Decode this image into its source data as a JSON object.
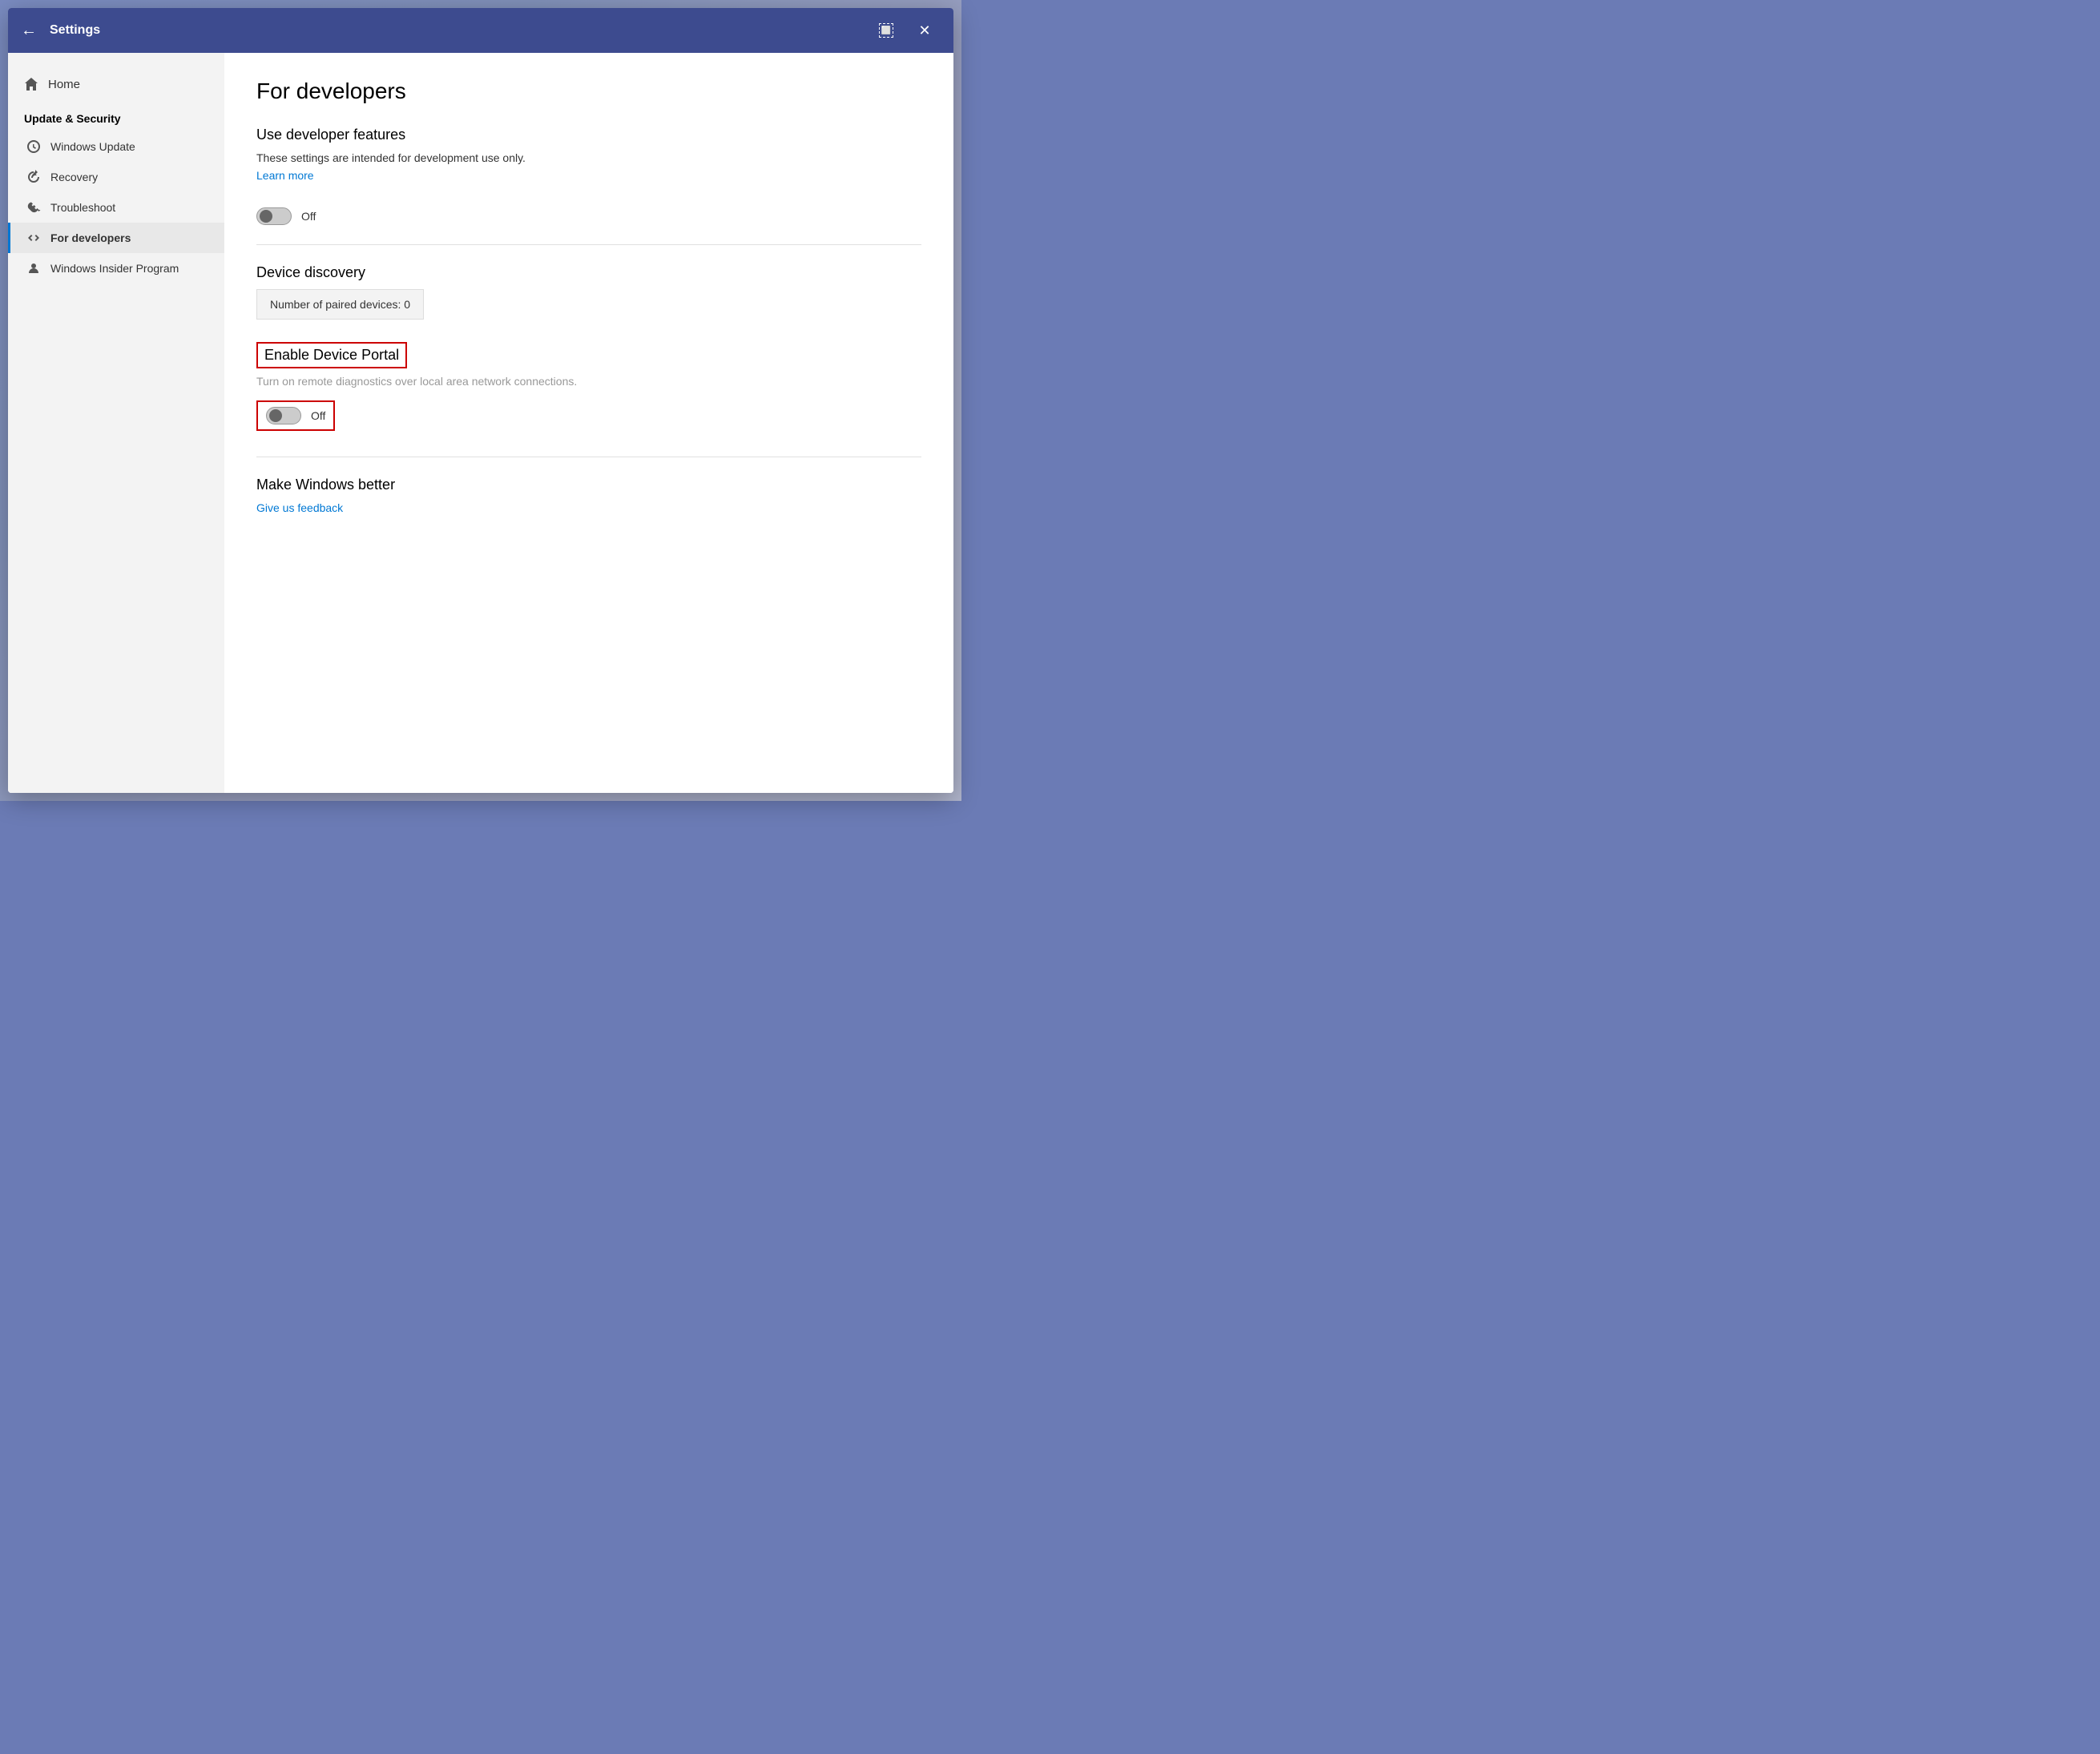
{
  "titleBar": {
    "title": "Settings",
    "backLabel": "←",
    "windowControls": {
      "snap": "⬜",
      "close": "✕"
    }
  },
  "sidebar": {
    "homeLabel": "Home",
    "sectionTitle": "Update & Security",
    "items": [
      {
        "id": "windows-update",
        "label": "Windows Update",
        "icon": "update"
      },
      {
        "id": "recovery",
        "label": "Recovery",
        "icon": "recovery"
      },
      {
        "id": "troubleshoot",
        "label": "Troubleshoot",
        "icon": "troubleshoot"
      },
      {
        "id": "for-developers",
        "label": "For developers",
        "icon": "developers",
        "active": true
      },
      {
        "id": "windows-insider",
        "label": "Windows Insider Program",
        "icon": "insider"
      }
    ]
  },
  "main": {
    "pageTitle": "For developers",
    "sections": {
      "developerFeatures": {
        "title": "Use developer features",
        "description": "These settings are intended for development use only.",
        "learnMoreLabel": "Learn more",
        "toggleLabel": "Off"
      },
      "deviceDiscovery": {
        "title": "Device discovery",
        "pairedDevices": "Number of paired devices: 0"
      },
      "enableDevicePortal": {
        "title": "Enable Device Portal",
        "description": "Turn on remote diagnostics over local area network connections.",
        "toggleLabel": "Off"
      },
      "makeWindowsBetter": {
        "title": "Make Windows better",
        "feedbackLabel": "Give us feedback"
      }
    }
  }
}
